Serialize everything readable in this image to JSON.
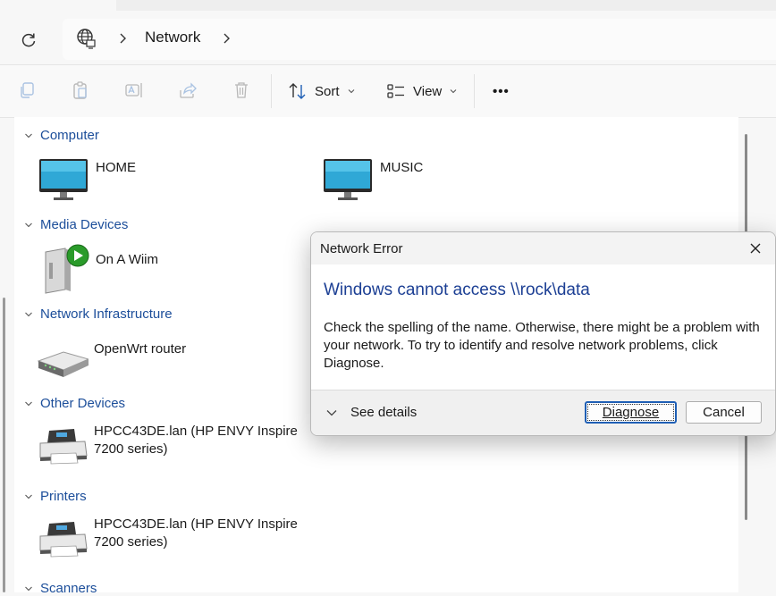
{
  "address": {
    "location_icon": "network-globe-icon",
    "crumb": "Network"
  },
  "toolbar": {
    "icons": [
      "copy-icon",
      "paste-icon",
      "rename-icon",
      "share-icon",
      "delete-icon"
    ],
    "sort_label": "Sort",
    "view_label": "View",
    "more_label": "•••"
  },
  "groups": [
    {
      "label": "Computer",
      "items": [
        {
          "name": "HOME",
          "icon": "monitor-icon"
        },
        {
          "name": "MUSIC",
          "icon": "monitor-icon"
        }
      ]
    },
    {
      "label": "Media Devices",
      "items": [
        {
          "name": "On A Wiim",
          "icon": "media-device-icon"
        }
      ]
    },
    {
      "label": "Network Infrastructure",
      "items": [
        {
          "name": "OpenWrt router",
          "icon": "router-icon"
        }
      ]
    },
    {
      "label": "Other Devices",
      "items": [
        {
          "name": "HPCC43DE.lan (HP ENVY Inspire 7200 series)",
          "icon": "printer-icon"
        }
      ]
    },
    {
      "label": "Printers",
      "items": [
        {
          "name": "HPCC43DE.lan (HP ENVY Inspire 7200 series)",
          "icon": "printer-icon"
        }
      ]
    },
    {
      "label": "Scanners",
      "items": []
    }
  ],
  "dialog": {
    "title": "Network Error",
    "main_instruction": "Windows cannot access \\\\rock\\data",
    "body": "Check the spelling of the name. Otherwise, there might be a problem with your network. To try to identify and resolve network problems, click Diagnose.",
    "see_details": "See details",
    "diagnose": "Diagnose",
    "cancel": "Cancel"
  },
  "colors": {
    "group_header": "#1c4e9a",
    "dialog_heading": "#1c3f94",
    "focus_border": "#1f5fb5"
  }
}
